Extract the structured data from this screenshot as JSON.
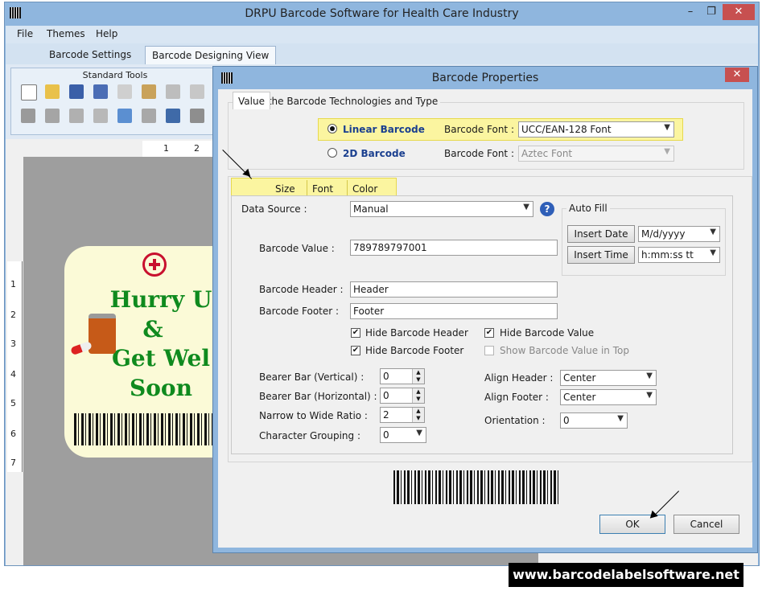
{
  "app": {
    "title": "DRPU Barcode Software for Health Care Industry",
    "menu": [
      "File",
      "Themes",
      "Help"
    ],
    "tabs": [
      "Barcode Settings",
      "Barcode Designing View"
    ],
    "toolbar_group": "Standard Tools"
  },
  "rulers": {
    "top": [
      "1",
      "2"
    ],
    "left": [
      "1",
      "2",
      "3",
      "4",
      "5",
      "6",
      "7"
    ]
  },
  "label": {
    "lines": [
      "Hurry U",
      "&",
      "Get Wel",
      "Soon"
    ]
  },
  "dialog": {
    "title": "Barcode Properties",
    "tech_group": "Select the Barcode Technologies and Type",
    "linear_label": "Linear Barcode",
    "linear_font_label": "Barcode Font :",
    "linear_font": "UCC/EAN-128 Font",
    "twod_label": "2D Barcode",
    "twod_font_label": "Barcode Font :",
    "twod_font": "Aztec Font",
    "tabs": [
      "Value",
      "Size",
      "Font",
      "Color"
    ],
    "data_source_label": "Data Source :",
    "data_source": "Manual",
    "help_icon": "?",
    "auto_fill": {
      "title": "Auto Fill",
      "insert_date": "Insert Date",
      "date_format": "M/d/yyyy",
      "insert_time": "Insert Time",
      "time_format": "h:mm:ss tt"
    },
    "barcode_value_label": "Barcode Value :",
    "barcode_value": "789789797001",
    "header_label": "Barcode Header :",
    "header_value": "Header",
    "footer_label": "Barcode Footer :",
    "footer_value": "Footer",
    "checks": {
      "hide_header": "Hide Barcode Header",
      "hide_footer": "Hide Barcode Footer",
      "hide_value": "Hide Barcode Value",
      "show_top": "Show Barcode Value in Top"
    },
    "bearer_v_label": "Bearer Bar (Vertical) :",
    "bearer_v": "0",
    "bearer_h_label": "Bearer Bar (Horizontal) :",
    "bearer_h": "0",
    "ratio_label": "Narrow to Wide Ratio :",
    "ratio": "2",
    "grouping_label": "Character Grouping :",
    "grouping": "0",
    "align_header_label": "Align Header :",
    "align_header": "Center",
    "align_footer_label": "Align Footer :",
    "align_footer": "Center",
    "orientation_label": "Orientation :",
    "orientation": "0",
    "ok": "OK",
    "cancel": "Cancel"
  },
  "footer_url": "www.barcodelabelsoftware.net"
}
